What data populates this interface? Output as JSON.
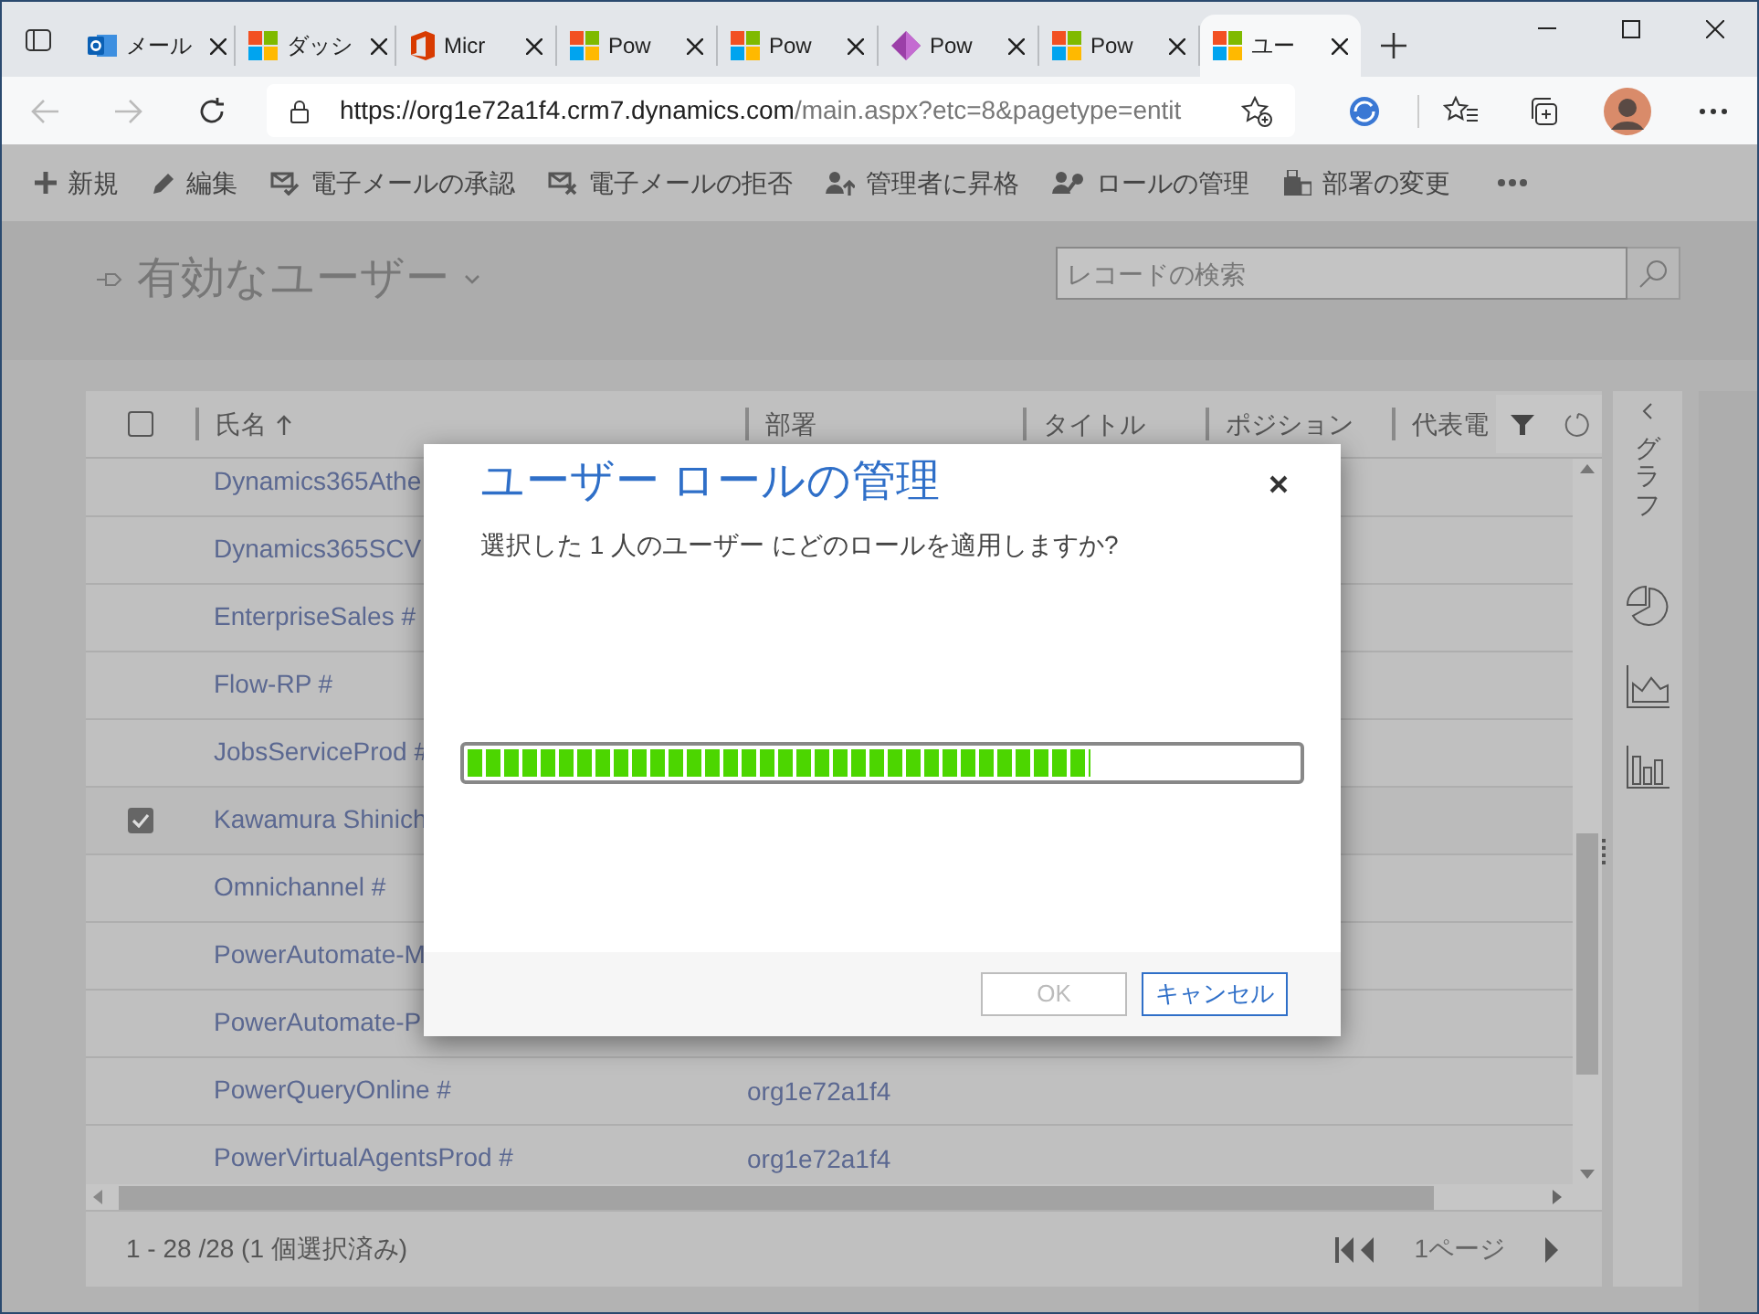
{
  "browser": {
    "tabs": [
      {
        "title": "メール",
        "kind": "mail",
        "selected": false
      },
      {
        "title": "ダッシ",
        "kind": "squares",
        "selected": false
      },
      {
        "title": "Micr",
        "kind": "office",
        "selected": false
      },
      {
        "title": "Pow",
        "kind": "squares",
        "selected": false
      },
      {
        "title": "Pow",
        "kind": "squares",
        "selected": false
      },
      {
        "title": "Pow",
        "kind": "diamond",
        "selected": false
      },
      {
        "title": "Pow",
        "kind": "squares",
        "selected": false
      },
      {
        "title": "ユー",
        "kind": "squares",
        "selected": true
      }
    ],
    "url": {
      "host": "https://org1e72a1f4.crm7.dynamics.com",
      "path": "/main.aspx?etc=8&pagetype=entit"
    }
  },
  "commands": [
    {
      "label": "新規",
      "kind": "plus"
    },
    {
      "label": "編集",
      "kind": "pencil"
    },
    {
      "label": "電子メールの承認",
      "kind": "mail-check"
    },
    {
      "label": "電子メールの拒否",
      "kind": "mail-x"
    },
    {
      "label": "管理者に昇格",
      "kind": "person-up"
    },
    {
      "label": "ロールの管理",
      "kind": "person-key"
    },
    {
      "label": "部署の変更",
      "kind": "building"
    }
  ],
  "view": {
    "title": "有効なユーザー",
    "search": {
      "placeholder": "レコードの検索"
    }
  },
  "grid": {
    "select_all_checked": false,
    "columns": [
      {
        "label": "氏名",
        "sorted": true
      },
      {
        "label": "部署",
        "sorted": false
      },
      {
        "label": "タイトル",
        "sorted": false
      },
      {
        "label": "ポジション",
        "sorted": false
      },
      {
        "label": "代表電",
        "sorted": false
      }
    ],
    "rows": [
      {
        "name": "Dynamics365Athe",
        "selected": false
      },
      {
        "name": "Dynamics365SCV",
        "selected": false
      },
      {
        "name": "EnterpriseSales #",
        "selected": false
      },
      {
        "name": "Flow-RP #",
        "selected": false
      },
      {
        "name": "JobsServiceProd #",
        "selected": false
      },
      {
        "name": "Kawamura Shinich",
        "selected": true
      },
      {
        "name": "Omnichannel #",
        "selected": false
      },
      {
        "name": "PowerAutomate-M",
        "selected": false
      },
      {
        "name": "PowerAutomate-P",
        "selected": false
      },
      {
        "name": "PowerQueryOnline #",
        "department": "org1e72a1f4",
        "selected": false
      },
      {
        "name": "PowerVirtualAgentsProd #",
        "department": "org1e72a1f4",
        "selected": false
      }
    ],
    "status": "1 - 28 /28 (1 個選択済み)",
    "page": "1ページ"
  },
  "side_panel": {
    "title": "グラフ"
  },
  "dialog": {
    "title": "ユーザー ロールの管理",
    "question": "選択した 1 人のユーザー にどのロールを適用しますか?",
    "progress": {
      "level": 0.75
    },
    "buttons": [
      {
        "label": "OK",
        "disabled": true
      },
      {
        "label": "キャンセル",
        "disabled": false
      }
    ]
  }
}
